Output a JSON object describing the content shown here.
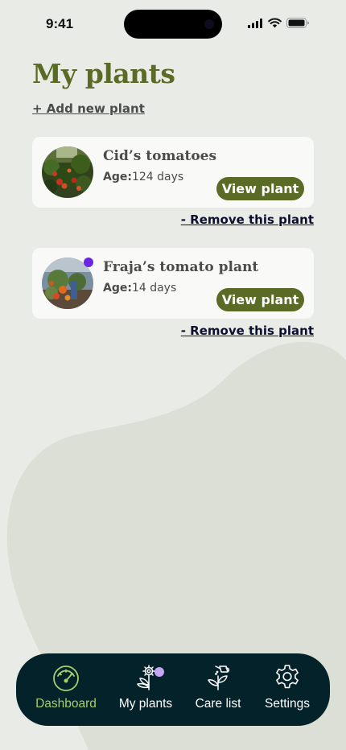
{
  "status_bar": {
    "time": "9:41"
  },
  "header": {
    "title": "My plants",
    "add_link": "+ Add new plant"
  },
  "plants": [
    {
      "name": "Cid’s tomatoes",
      "age_label": "Age:",
      "age_value": "124 days",
      "view_label": "View plant",
      "remove_label": "- Remove this plant",
      "has_notification": false
    },
    {
      "name": "Fraja’s tomato plant",
      "age_label": "Age:",
      "age_value": "14 days",
      "view_label": "View plant",
      "remove_label": "- Remove this plant",
      "has_notification": true
    }
  ],
  "nav": {
    "items": [
      {
        "label": "Dashboard",
        "icon": "speedometer-icon",
        "active": true
      },
      {
        "label": "My plants",
        "icon": "plant-gear-icon",
        "active": false,
        "has_notification": true
      },
      {
        "label": "Care list",
        "icon": "watering-can-plant-icon",
        "active": false
      },
      {
        "label": "Settings",
        "icon": "gear-icon",
        "active": false
      }
    ]
  },
  "colors": {
    "background": "#e9ebe6",
    "blob": "#dcdfd6",
    "accent_green": "#5a6b26",
    "nav_background": "#03222a",
    "nav_active": "#a7cf6c",
    "notification_purple": "#6b26e0",
    "nav_notification": "#c3a6f5"
  }
}
